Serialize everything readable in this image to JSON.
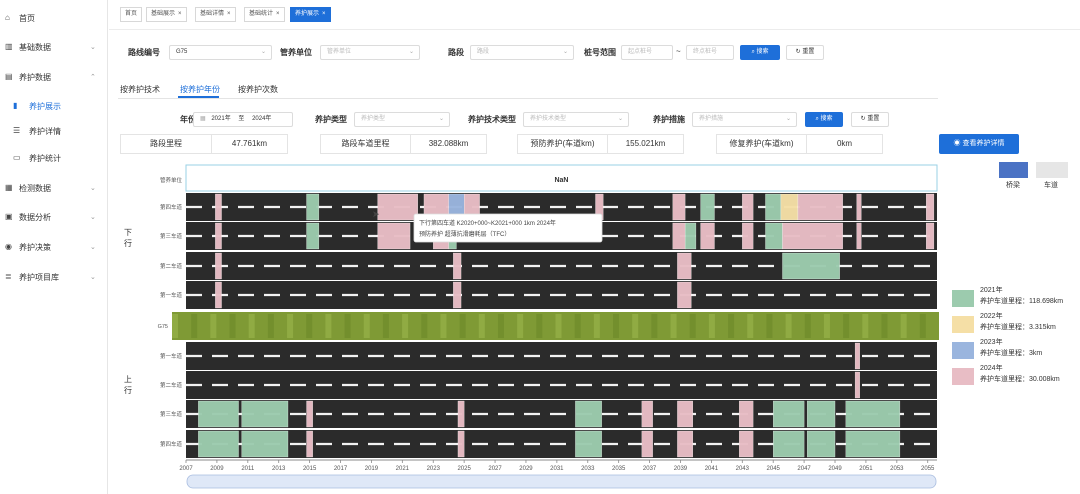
{
  "sidebar": {
    "items": [
      {
        "label": "首页",
        "icon": "home-icon",
        "glyph": "⌂",
        "chevron": "",
        "level": 0
      },
      {
        "label": "基础数据",
        "icon": "bar-chart-icon",
        "glyph": "▥",
        "chevron": "⌄",
        "level": 0
      },
      {
        "label": "养护数据",
        "icon": "document-icon",
        "glyph": "▤",
        "chevron": "⌃",
        "level": 0
      },
      {
        "label": "养护展示",
        "icon": "chart-icon",
        "glyph": "▮",
        "chevron": "",
        "level": 1,
        "active": true
      },
      {
        "label": "养护详情",
        "icon": "list-icon",
        "glyph": "☰",
        "chevron": "",
        "level": 1
      },
      {
        "label": "养护统计",
        "icon": "monitor-icon",
        "glyph": "▭",
        "chevron": "",
        "level": 1
      },
      {
        "label": "检测数据",
        "icon": "inspection-icon",
        "glyph": "▦",
        "chevron": "⌄",
        "level": 0
      },
      {
        "label": "数据分析",
        "icon": "analysis-icon",
        "glyph": "▣",
        "chevron": "⌄",
        "level": 0
      },
      {
        "label": "养护决策",
        "icon": "decision-icon",
        "glyph": "◉",
        "chevron": "⌄",
        "level": 0
      },
      {
        "label": "养护项目库",
        "icon": "project-icon",
        "glyph": "≣",
        "chevron": "⌄",
        "level": 0
      }
    ]
  },
  "tabs": [
    {
      "label": "首页",
      "close": ""
    },
    {
      "label": "基础展示",
      "close": "×"
    },
    {
      "label": "基础详情",
      "close": "×"
    },
    {
      "label": "基础统计",
      "close": "×"
    },
    {
      "label": "养护展示",
      "close": "×",
      "active": true
    }
  ],
  "filters": {
    "route_label": "路线编号",
    "route_value": "G75",
    "unit_label": "管养单位",
    "unit_placeholder": "管养单位",
    "section_label": "路段",
    "section_placeholder": "路段",
    "stake_label": "桩号范围",
    "stake_start_placeholder": "起点桩号",
    "stake_sep": "~",
    "stake_end_placeholder": "终点桩号",
    "search_label": "搜索",
    "reset_label": "重置"
  },
  "subtabs": {
    "a": "按养护技术",
    "b": "按养护年份",
    "c": "按养护次数"
  },
  "filters2": {
    "year_label": "年份",
    "year_start": "2021年",
    "year_sep": "至",
    "year_end": "2024年",
    "type_label": "养护类型",
    "type_placeholder": "养护类型",
    "tech_label": "养护技术类型",
    "tech_placeholder": "养护技术类型",
    "measure_label": "养护措施",
    "measure_placeholder": "养护措施",
    "search_label": "搜索",
    "reset_label": "重置"
  },
  "stats": {
    "section_mileage_label": "路段里程",
    "section_mileage_value": "47.761km",
    "lane_mileage_label": "路段车道里程",
    "lane_mileage_value": "382.088km",
    "preventive_label": "预防养护(车道km)",
    "preventive_value": "155.021km",
    "repair_label": "修复养护(车道km)",
    "repair_value": "0km",
    "detail_button": "查看养护详情"
  },
  "chart_data": {
    "type": "gantt",
    "title": "NaN",
    "header_row_label": "管养单位",
    "direction_down": "下\n行",
    "direction_up": "上\n行",
    "median_label": "G75",
    "rows_down": [
      "第四车道",
      "第三车道",
      "第二车道",
      "第一车道"
    ],
    "rows_up": [
      "第一车道",
      "第二车道",
      "第三车道",
      "第四车道"
    ],
    "xlim": [
      2007,
      2055.6
    ],
    "x_ticks": [
      2007,
      2009,
      2011,
      2013,
      2015,
      2017,
      2019,
      2021,
      2023,
      2025,
      2027,
      2029,
      2031,
      2033,
      2035,
      2037,
      2039,
      2041,
      2043,
      2045,
      2047,
      2049,
      2051,
      2053,
      2055
    ],
    "series": [
      {
        "name": "2021年",
        "color": "#9ccbae",
        "lane_mileage": "养护车道里程：118.698km"
      },
      {
        "name": "2022年",
        "color": "#f5dfa6",
        "lane_mileage": "养护车道里程：3.315km"
      },
      {
        "name": "2023年",
        "color": "#9ab5de",
        "lane_mileage": "养护车道里程：3km"
      },
      {
        "name": "2024年",
        "color": "#e8bdc5",
        "lane_mileage": "养护车道里程：30.008km"
      }
    ],
    "segments": [
      {
        "row": "d4",
        "start": 2008.9,
        "end": 2009.3,
        "year": "2024年"
      },
      {
        "row": "d4",
        "start": 2014.8,
        "end": 2015.6,
        "year": "2021年"
      },
      {
        "row": "d4",
        "start": 2019.4,
        "end": 2022.0,
        "year": "2024年"
      },
      {
        "row": "d4",
        "start": 2022.4,
        "end": 2024.0,
        "year": "2024年"
      },
      {
        "row": "d4",
        "start": 2024.0,
        "end": 2025.0,
        "year": "2023年"
      },
      {
        "row": "d4",
        "start": 2025.0,
        "end": 2026.0,
        "year": "2024年"
      },
      {
        "row": "d4",
        "start": 2033.5,
        "end": 2034.0,
        "year": "2024年"
      },
      {
        "row": "d4",
        "start": 2038.5,
        "end": 2039.3,
        "year": "2024年"
      },
      {
        "row": "d4",
        "start": 2040.3,
        "end": 2041.2,
        "year": "2021年"
      },
      {
        "row": "d4",
        "start": 2043.0,
        "end": 2043.7,
        "year": "2024年"
      },
      {
        "row": "d4",
        "start": 2044.5,
        "end": 2045.5,
        "year": "2021年"
      },
      {
        "row": "d4",
        "start": 2045.5,
        "end": 2046.6,
        "year": "2022年"
      },
      {
        "row": "d4",
        "start": 2046.6,
        "end": 2049.5,
        "year": "2024年"
      },
      {
        "row": "d4",
        "start": 2050.4,
        "end": 2050.7,
        "year": "2024年"
      },
      {
        "row": "d4",
        "start": 2054.9,
        "end": 2055.4,
        "year": "2024年"
      },
      {
        "row": "d3",
        "start": 2008.9,
        "end": 2009.3,
        "year": "2024年"
      },
      {
        "row": "d3",
        "start": 2014.8,
        "end": 2015.6,
        "year": "2021年"
      },
      {
        "row": "d3",
        "start": 2019.4,
        "end": 2021.5,
        "year": "2024年"
      },
      {
        "row": "d3",
        "start": 2023.0,
        "end": 2024.0,
        "year": "2024年"
      },
      {
        "row": "d3",
        "start": 2024.0,
        "end": 2024.5,
        "year": "2021年"
      },
      {
        "row": "d3",
        "start": 2038.5,
        "end": 2039.3,
        "year": "2024年"
      },
      {
        "row": "d3",
        "start": 2039.3,
        "end": 2040.0,
        "year": "2021年"
      },
      {
        "row": "d3",
        "start": 2040.3,
        "end": 2041.2,
        "year": "2024年"
      },
      {
        "row": "d3",
        "start": 2043.0,
        "end": 2043.7,
        "year": "2024年"
      },
      {
        "row": "d3",
        "start": 2044.5,
        "end": 2045.6,
        "year": "2021年"
      },
      {
        "row": "d3",
        "start": 2045.6,
        "end": 2049.5,
        "year": "2024年"
      },
      {
        "row": "d3",
        "start": 2050.4,
        "end": 2050.7,
        "year": "2024年"
      },
      {
        "row": "d3",
        "start": 2054.9,
        "end": 2055.4,
        "year": "2024年"
      },
      {
        "row": "d2",
        "start": 2008.9,
        "end": 2009.3,
        "year": "2024年"
      },
      {
        "row": "d2",
        "start": 2024.3,
        "end": 2024.8,
        "year": "2024年"
      },
      {
        "row": "d2",
        "start": 2038.8,
        "end": 2039.7,
        "year": "2024年"
      },
      {
        "row": "d2",
        "start": 2045.6,
        "end": 2049.3,
        "year": "2021年"
      },
      {
        "row": "d1",
        "start": 2008.9,
        "end": 2009.3,
        "year": "2024年"
      },
      {
        "row": "d1",
        "start": 2024.3,
        "end": 2024.8,
        "year": "2024年"
      },
      {
        "row": "d1",
        "start": 2038.8,
        "end": 2039.7,
        "year": "2024年"
      },
      {
        "row": "u1",
        "start": 2050.3,
        "end": 2050.6,
        "year": "2024年"
      },
      {
        "row": "u2",
        "start": 2050.3,
        "end": 2050.6,
        "year": "2024年"
      },
      {
        "row": "u3",
        "start": 2007.8,
        "end": 2010.4,
        "year": "2021年"
      },
      {
        "row": "u3",
        "start": 2010.6,
        "end": 2013.6,
        "year": "2021年"
      },
      {
        "row": "u3",
        "start": 2014.8,
        "end": 2015.2,
        "year": "2024年"
      },
      {
        "row": "u3",
        "start": 2024.6,
        "end": 2025.0,
        "year": "2024年"
      },
      {
        "row": "u3",
        "start": 2032.2,
        "end": 2033.9,
        "year": "2021年"
      },
      {
        "row": "u3",
        "start": 2036.5,
        "end": 2037.2,
        "year": "2024年"
      },
      {
        "row": "u3",
        "start": 2038.8,
        "end": 2039.8,
        "year": "2024年"
      },
      {
        "row": "u3",
        "start": 2042.8,
        "end": 2043.7,
        "year": "2024年"
      },
      {
        "row": "u3",
        "start": 2045.0,
        "end": 2047.0,
        "year": "2021年"
      },
      {
        "row": "u3",
        "start": 2047.2,
        "end": 2049.0,
        "year": "2021年"
      },
      {
        "row": "u3",
        "start": 2049.7,
        "end": 2053.2,
        "year": "2021年"
      },
      {
        "row": "u4",
        "start": 2007.8,
        "end": 2010.4,
        "year": "2021年"
      },
      {
        "row": "u4",
        "start": 2010.6,
        "end": 2013.6,
        "year": "2021年"
      },
      {
        "row": "u4",
        "start": 2014.8,
        "end": 2015.2,
        "year": "2024年"
      },
      {
        "row": "u4",
        "start": 2024.6,
        "end": 2025.0,
        "year": "2024年"
      },
      {
        "row": "u4",
        "start": 2032.2,
        "end": 2033.9,
        "year": "2021年"
      },
      {
        "row": "u4",
        "start": 2036.5,
        "end": 2037.2,
        "year": "2024年"
      },
      {
        "row": "u4",
        "start": 2038.8,
        "end": 2039.8,
        "year": "2024年"
      },
      {
        "row": "u4",
        "start": 2042.8,
        "end": 2043.7,
        "year": "2024年"
      },
      {
        "row": "u4",
        "start": 2045.0,
        "end": 2047.0,
        "year": "2021年"
      },
      {
        "row": "u4",
        "start": 2047.2,
        "end": 2049.0,
        "year": "2021年"
      },
      {
        "row": "u4",
        "start": 2049.7,
        "end": 2053.2,
        "year": "2021年"
      }
    ],
    "tooltip": {
      "line1": "下行第四车道 K2020+000~K2021+000 1km 2024年",
      "line2": "预防养护 超薄抗滑磨耗层（TFC）"
    },
    "top_legend": {
      "bridge": "桥梁",
      "lane": "车道",
      "bridge_color": "#4a72c4",
      "lane_color": "#e6e6e6"
    }
  }
}
